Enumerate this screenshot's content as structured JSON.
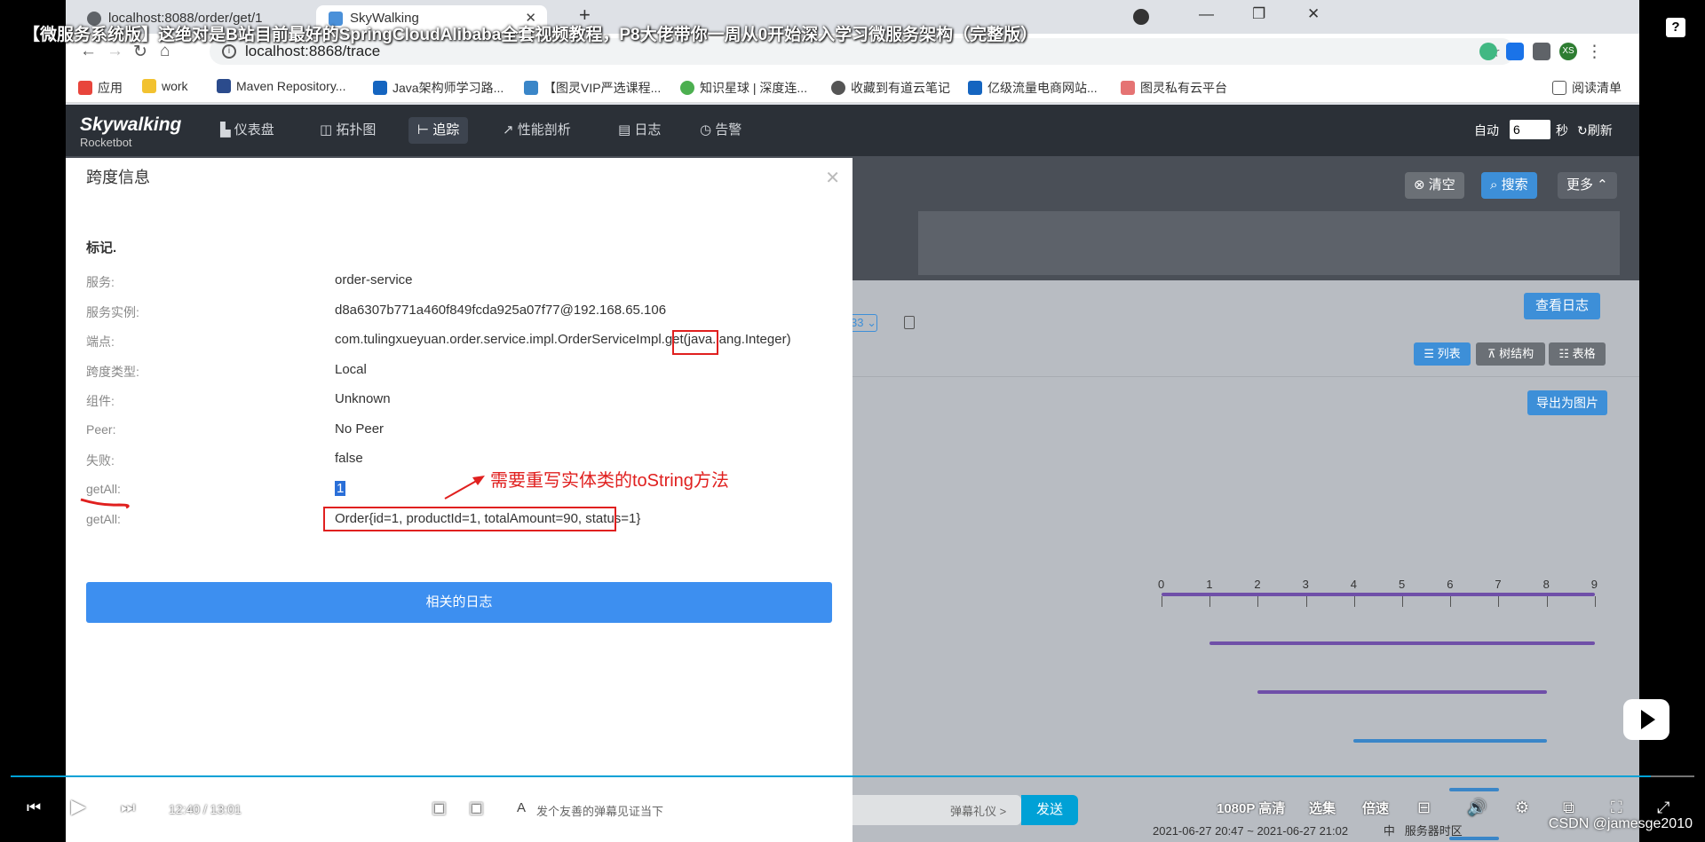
{
  "overlay": {
    "video_title": "【微服务系统版】这绝对是B站目前最好的SpringCloudAlibaba全套视频教程，P8大佬带你一周从0开始深入学习微服务架构（完整版）",
    "help_icon": "?",
    "watermark": "CSDN @jamesge2010"
  },
  "browser": {
    "tabs": [
      {
        "label": "localhost:8088/order/get/1"
      },
      {
        "label": "SkyWalking"
      }
    ],
    "url": "localhost:8868/trace",
    "profile_initials": "XS",
    "bookmarks": [
      {
        "label": "应用"
      },
      {
        "label": "work"
      },
      {
        "label": "Maven Repository..."
      },
      {
        "label": "Java架构师学习路..."
      },
      {
        "label": "【图灵VIP严选课程..."
      },
      {
        "label": "知识星球 | 深度连..."
      },
      {
        "label": "收藏到有道云笔记"
      },
      {
        "label": "亿级流量电商网站..."
      },
      {
        "label": "图灵私有云平台"
      }
    ],
    "reading_list": "阅读清单"
  },
  "app": {
    "logo_main": "Skywalking",
    "logo_sub": "Rocketbot",
    "nav": [
      {
        "label": "仪表盘"
      },
      {
        "label": "拓扑图"
      },
      {
        "label": "追踪"
      },
      {
        "label": "性能剖析"
      },
      {
        "label": "日志"
      },
      {
        "label": "告警"
      }
    ],
    "auto_label": "自动",
    "auto_value": "6",
    "seconds_label": "秒",
    "refresh_label": "刷新",
    "clear_label": "清空",
    "search_label": "搜索",
    "more_label": "更多",
    "view_logs_label": "查看日志",
    "list_label": "列表",
    "tree_label": "树结构",
    "table_label": "表格",
    "export_label": "导出为图片",
    "select_fragment": "33",
    "axis_ticks": [
      "0",
      "1",
      "2",
      "3",
      "4",
      "5",
      "6",
      "7",
      "8",
      "9"
    ],
    "colors": {
      "bar_purple": "#6f4fa8",
      "bar_blue": "#3a86c8"
    }
  },
  "modal": {
    "title": "跨度信息",
    "section": "标记.",
    "rows": [
      {
        "label": "服务:",
        "value": "order-service"
      },
      {
        "label": "服务实例:",
        "value": "d8a6307b771a460f849fcda925a07f77@192.168.65.106"
      },
      {
        "label": "端点:",
        "value": "com.tulingxueyuan.order.service.impl.OrderServiceImpl.get(java.lang.Integer)"
      },
      {
        "label": "跨度类型:",
        "value": "Local"
      },
      {
        "label": "组件:",
        "value": "Unknown"
      },
      {
        "label": "Peer:",
        "value": "No Peer"
      },
      {
        "label": "失败:",
        "value": "false"
      },
      {
        "label": "getAll:",
        "value": "1"
      },
      {
        "label": "getAll:",
        "value": "Order{id=1, productId=1, totalAmount=90, status=1}"
      }
    ],
    "annotation": "需要重写实体类的toString方法",
    "related_logs": "相关的日志"
  },
  "player": {
    "time_current": "12:40",
    "time_sep": "/",
    "time_total": "13:01",
    "progress": 0.974,
    "danmaku_placeholder": "发个友善的弹幕见证当下",
    "gift_label": "弹幕礼仪 >",
    "send_label": "发送",
    "quality": "1080P 高清",
    "episodes": "选集",
    "speed": "倍速",
    "date_range": "2021-06-27 20:47 ~ 2021-06-27 21:02",
    "tz_mid": "中",
    "tz_label": "服务器时区"
  }
}
